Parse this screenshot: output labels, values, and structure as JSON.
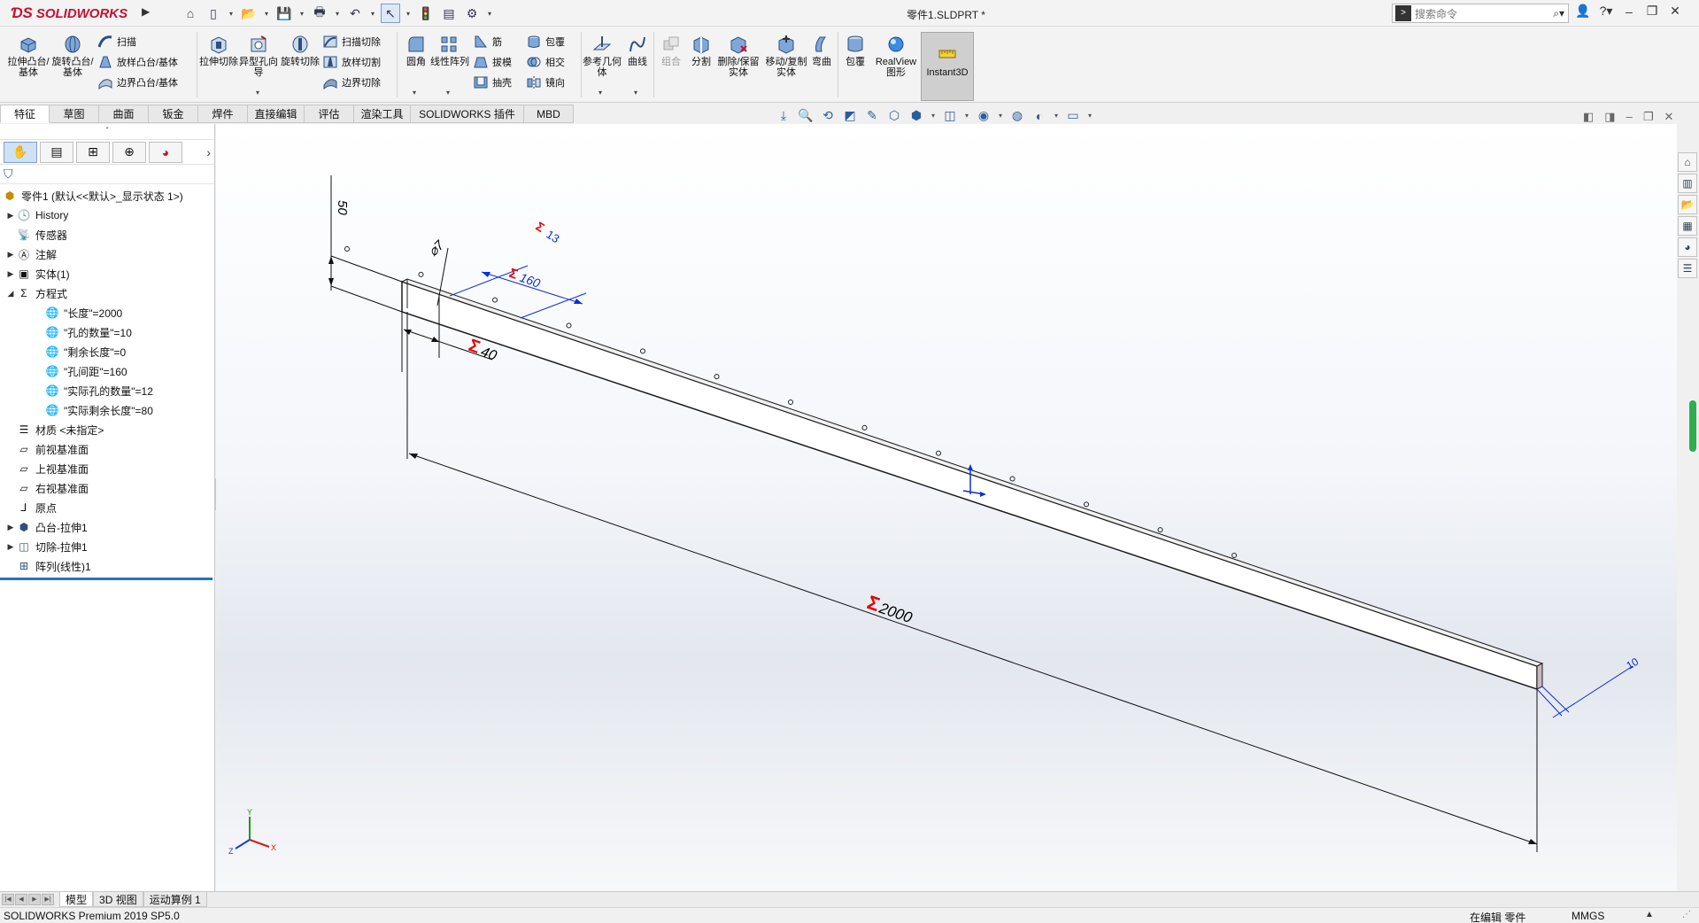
{
  "app": {
    "logo_text": "SOLIDWORKS",
    "document_title": "零件1.SLDPRT *",
    "search_placeholder": "搜索命令"
  },
  "ribbon": {
    "extrude_boss": "拉伸凸台/基体",
    "revolve_boss": "旋转凸台/基体",
    "sweep": "扫描",
    "loft_boss": "放样凸台/基体",
    "boundary_boss": "边界凸台/基体",
    "extrude_cut": "拉伸切除",
    "hole_wizard": "异型孔向导",
    "revolve_cut": "旋转切除",
    "sweep_cut": "扫描切除",
    "loft_cut": "放样切割",
    "boundary_cut": "边界切除",
    "fillet": "圆角",
    "linear_pattern": "线性阵列",
    "rib": "筋",
    "draft": "拔模",
    "shell": "抽壳",
    "wrap": "包覆",
    "intersect": "相交",
    "mirror": "镜向",
    "ref_geometry": "参考几何体",
    "curves": "曲线",
    "combine": "组合",
    "split": "分割",
    "delete_keep_body": "删除/保留实体",
    "move_copy_body": "移动/复制实体",
    "flex": "弯曲",
    "wrap2": "包覆",
    "realview": "RealView 图形",
    "instant3d": "Instant3D"
  },
  "command_tabs": [
    "特征",
    "草图",
    "曲面",
    "钣金",
    "焊件",
    "直接编辑",
    "评估",
    "渲染工具",
    "SOLIDWORKS 插件",
    "MBD"
  ],
  "tree": {
    "root": "零件1 (默认<<默认>_显示状态 1>)",
    "history": "History",
    "sensors": "传感器",
    "annotations": "注解",
    "solid_bodies": "实体(1)",
    "equations": "方程式",
    "eq1": "\"长度\"=2000",
    "eq2": "\"孔的数量\"=10",
    "eq3": "\"剩余长度\"=0",
    "eq4": "\"孔间距\"=160",
    "eq5": "\"实际孔的数量\"=12",
    "eq6": "\"实际剩余长度\"=80",
    "material": "材质 <未指定>",
    "front_plane": "前视基准面",
    "top_plane": "上视基准面",
    "right_plane": "右视基准面",
    "origin": "原点",
    "boss_extrude": "凸台-拉伸1",
    "cut_extrude": "切除-拉伸1",
    "linear_pattern": "阵列(线性)1"
  },
  "dimensions": {
    "height": "50",
    "diameter": "⌀7",
    "hole_count": "13",
    "spacing": "160",
    "edge_offset": "40",
    "length": "2000",
    "thickness": "10",
    "sigma": "Σ"
  },
  "triad": {
    "x": "X",
    "y": "Y",
    "z": "Z"
  },
  "bottom_tabs": [
    "模型",
    "3D 视图",
    "运动算例 1"
  ],
  "status": {
    "version": "SOLIDWORKS Premium 2019 SP5.0",
    "mode": "在编辑 零件",
    "units": "MMGS"
  },
  "colors": {
    "brand_red": "#c8102e",
    "dimension_blue": "#0b2fd6",
    "sigma_red": "#e60000",
    "selection_blue": "#1d77c6"
  },
  "icons": {
    "home": "home-icon",
    "new": "new-document-icon",
    "open": "open-folder-icon",
    "save": "save-icon",
    "print": "print-icon",
    "undo": "undo-icon",
    "select": "select-cursor-icon",
    "rebuild": "traffic-light-icon",
    "file_props": "file-properties-icon",
    "options": "gear-icon"
  }
}
